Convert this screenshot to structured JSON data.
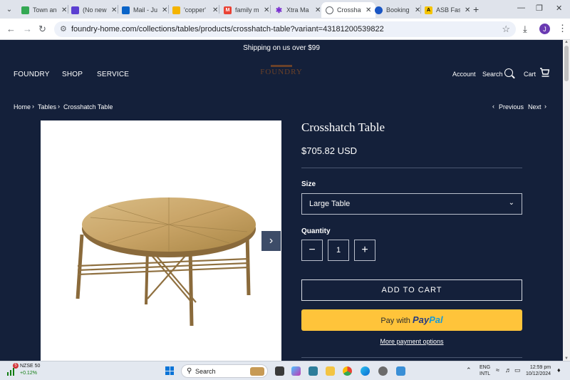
{
  "browser": {
    "tabs": [
      {
        "title": "Town and",
        "favicon_color": "#34a853",
        "active": false
      },
      {
        "title": "(No new",
        "favicon_color": "#5b3fd1",
        "active": false
      },
      {
        "title": "Mail - Ju",
        "favicon_color": "#0a64c8",
        "active": false
      },
      {
        "title": "'copper'",
        "favicon_color": "#f4b400",
        "active": false
      },
      {
        "title": "family m",
        "favicon_color": "#ea4335",
        "active": false
      },
      {
        "title": "Xtra Ma",
        "favicon_color": "#7a2fd0",
        "active": false
      },
      {
        "title": "Crosshat",
        "favicon_color": "#5f6368",
        "active": true
      },
      {
        "title": "Booking",
        "favicon_color": "#1a56c4",
        "active": false
      },
      {
        "title": "ASB Fas",
        "favicon_color": "#f5c400",
        "active": false
      }
    ],
    "url": "foundry-home.com/collections/tables/products/crosshatch-table?variant=43181200539822",
    "profile_initial": "J"
  },
  "site": {
    "announcement": "Shipping on us over $99",
    "nav": {
      "brand": "FOUNDRY",
      "shop": "SHOP",
      "service": "SERVICE"
    },
    "logo_text": "FOUNDRY",
    "header_right": {
      "account": "Account",
      "search": "Search",
      "cart": "Cart"
    },
    "breadcrumb": [
      "Home",
      "Tables",
      "Crosshatch Table"
    ],
    "pager": {
      "previous": "Previous",
      "next": "Next"
    },
    "product": {
      "title": "Crosshatch Table",
      "price": "$705.82 USD",
      "size_label": "Size",
      "size_value": "Large Table",
      "quantity_label": "Quantity",
      "quantity_value": "1",
      "add_to_cart": "ADD TO CART",
      "paypal_prefix": "Pay with",
      "paypal_brand_1": "Pay",
      "paypal_brand_2": "Pal",
      "more_payment": "More payment options"
    }
  },
  "taskbar": {
    "stock_name": "NZSE 50",
    "stock_change": "+0.12%",
    "stock_badge": "5",
    "search_placeholder": "Search",
    "lang_1": "ENG",
    "lang_2": "INTL",
    "time": "12:59 pm",
    "date": "10/12/2024"
  }
}
